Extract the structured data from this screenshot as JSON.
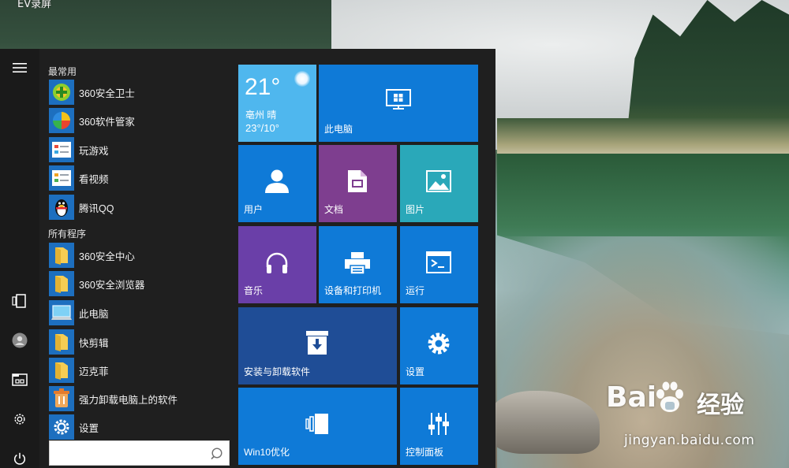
{
  "window_title": "EV录屏",
  "start_menu": {
    "sections": {
      "most_used": "最常用",
      "all_programs": "所有程序"
    },
    "most_used_items": [
      {
        "label": "360安全卫士",
        "icon": "360-safe-guard-icon"
      },
      {
        "label": "360软件管家",
        "icon": "360-software-manager-icon"
      },
      {
        "label": "玩游戏",
        "icon": "game-icon"
      },
      {
        "label": "看视频",
        "icon": "video-icon"
      },
      {
        "label": "腾讯QQ",
        "icon": "qq-penguin-icon"
      }
    ],
    "all_programs_items": [
      {
        "label": "360安全中心",
        "icon": "folder-icon"
      },
      {
        "label": "360安全浏览器",
        "icon": "folder-icon"
      },
      {
        "label": "此电脑",
        "icon": "this-pc-icon"
      },
      {
        "label": "快剪辑",
        "icon": "folder-icon"
      },
      {
        "label": "迈克菲",
        "icon": "folder-icon"
      },
      {
        "label": "强力卸载电脑上的软件",
        "icon": "uninstaller-icon"
      },
      {
        "label": "设置",
        "icon": "settings-gear-icon"
      }
    ],
    "search": {
      "value": "",
      "placeholder": ""
    },
    "rail_icons": [
      "hamburger-menu-icon",
      "tablet-mode-icon",
      "user-account-icon",
      "file-explorer-icon",
      "settings-icon",
      "power-icon"
    ]
  },
  "tiles": {
    "weather": {
      "temp": "21°",
      "city": "亳州  晴",
      "range": "23°/10°",
      "color": "#4fb7ee"
    },
    "this_pc": {
      "label": "此电脑",
      "color": "#0f7ad7"
    },
    "users": {
      "label": "用户",
      "color": "#0f7ad7"
    },
    "documents": {
      "label": "文档",
      "color": "#7e3e8f"
    },
    "pictures": {
      "label": "图片",
      "color": "#2aa8b9"
    },
    "music": {
      "label": "音乐",
      "color": "#6a3fa8"
    },
    "devices_printers": {
      "label": "设备和打印机",
      "color": "#0f7ad7"
    },
    "run": {
      "label": "运行",
      "color": "#0f7ad7"
    },
    "install_uninstall": {
      "label": "安装与卸载软件",
      "color": "#1f4d96"
    },
    "settings": {
      "label": "设置",
      "color": "#0f7ad7"
    },
    "win10_optimize": {
      "label": "Win10优化",
      "color": "#0f7ad7"
    },
    "control_panel": {
      "label": "控制面板",
      "color": "#0f7ad7"
    }
  },
  "watermark": {
    "baidu_logo": "Bai",
    "baidu_logo_suffix": "经验",
    "url": "jingyan.baidu.com"
  }
}
